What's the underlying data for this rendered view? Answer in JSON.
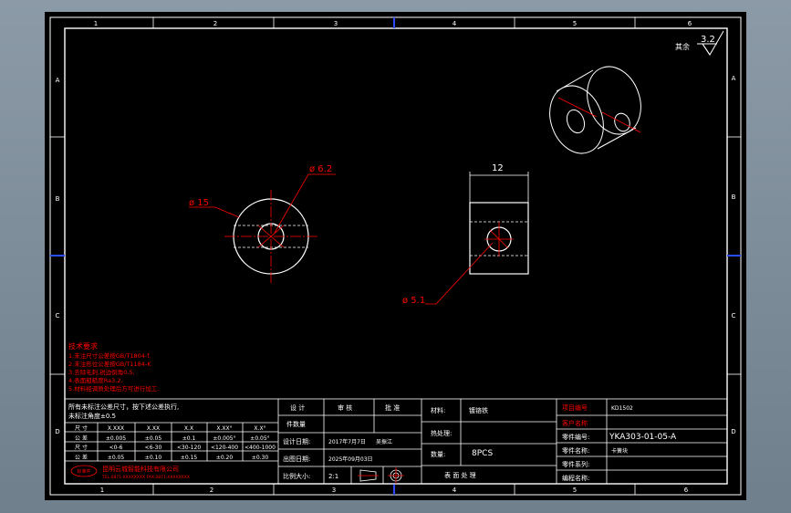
{
  "frame": {
    "col_numbers": [
      "1",
      "2",
      "3",
      "4",
      "5",
      "6"
    ],
    "row_letters": [
      "A",
      "B",
      "C",
      "D"
    ]
  },
  "roughness": {
    "label": "其余",
    "value": "3.2"
  },
  "dimensions": {
    "d15": "ø 15",
    "d62": "ø 6.2",
    "len12": "12",
    "d51": "ø 5.1"
  },
  "tech_notes": {
    "title": "技术要求",
    "lines": [
      "1.未注尺寸公差按GB/T1804-f.",
      "2.未注形位公差按GB/T1184-K",
      "3.去除毛刺,锐边倒角0.5,",
      "4.表面粗糙度Ra3.2,",
      "5.材料经调质处理后方可进行加工."
    ]
  },
  "tolerance": {
    "note1": "所有未标注公差尺寸，按下述公差执行,",
    "note2": "未标注角度±0.5",
    "rows": [
      [
        "尺 寸",
        "X.XXX",
        "X.XX",
        "X.X",
        "X.XX°",
        "X.X°"
      ],
      [
        "公 差",
        "±0.005",
        "±0.05",
        "±0.1",
        "±0.005°",
        "±0.05°"
      ],
      [
        "尺 寸",
        "<0-6",
        "<6-30",
        "<30-120",
        "<120-400",
        "<400-1000"
      ],
      [
        "公 差",
        "±0.05",
        "±0.10",
        "±0.15",
        "±0.20",
        "±0.30"
      ]
    ]
  },
  "company": {
    "logo": "标准件",
    "name": "昆明云城智能科技有限公司",
    "sub": "TEL:0871-XXXXXXXX  FAX:0871-XXXXXXXX"
  },
  "approval": {
    "design": "设 计",
    "review": "审 核",
    "approve": "批 准",
    "num": "件数量",
    "design_date_label": "设计日期:",
    "design_date": "2017年7月7日",
    "review_person": "吴振江",
    "plot_date_label": "出图日期:",
    "plot_date": "2025年09月03日",
    "scale_label": "比例大小:",
    "scale": "2:1"
  },
  "material": {
    "material_label": "材料:",
    "material": "镀铬铁",
    "heat_label": "热处理:",
    "qty_label": "数量:",
    "qty": "8PCS",
    "surface_label": "表 面 处 理"
  },
  "info": {
    "project_label": "项目编号",
    "project": "KD1502",
    "customer_label": "客户名称",
    "part_no_label": "零件编号:",
    "part_no": "YKA303-01-05-A",
    "part_name_label": "零件名称:",
    "part_name": "卡簧块",
    "sub_label": "零件系列:",
    "prog_label": "编程名称:"
  },
  "colors": {
    "paper": "#000000",
    "line": "#ffffff",
    "dim": "#ff0000",
    "center": "#ff0000",
    "frame_blue": "#2d4bff"
  }
}
